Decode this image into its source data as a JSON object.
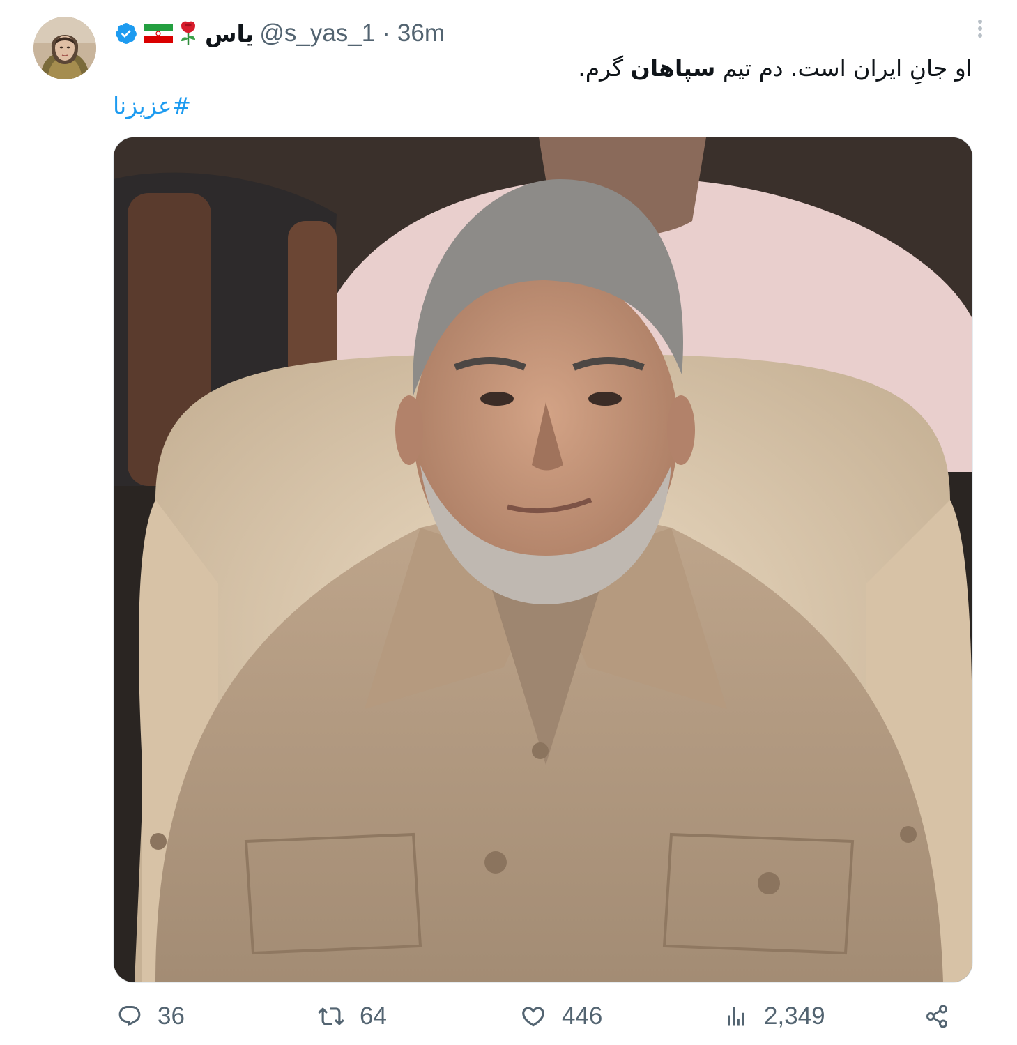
{
  "tweet": {
    "author": {
      "display_name": "یاس",
      "handle": "@s_yas_1",
      "flag_emoji": "🇮🇷",
      "rose_emoji": "🌹",
      "verified": true,
      "verified_color": "#1d9bf0"
    },
    "separator": "·",
    "timestamp": "36m",
    "text": {
      "part1": "او جانِ ایران است. دم تیم ",
      "bold": "سپاهان",
      "part2": " گرم."
    },
    "hashtag": "#عزیزنا",
    "hashtag_color": "#1d9bf0",
    "media": {
      "description_icon": "photo"
    },
    "actions": {
      "replies": "36",
      "retweets": "64",
      "likes": "446",
      "views": "2,349"
    },
    "icons": {
      "reply": "reply-icon",
      "retweet": "retweet-icon",
      "like": "heart-icon",
      "views": "views-icon",
      "share": "share-icon",
      "more": "more-icon"
    }
  }
}
